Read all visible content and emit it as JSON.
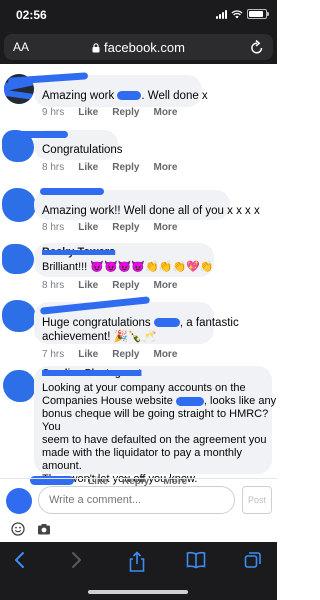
{
  "status_bar": {
    "time": "02:56"
  },
  "browser": {
    "aa_label": "AA",
    "url": "facebook.com"
  },
  "comments": [
    {
      "author": "",
      "text_before": "Amazing work ",
      "text_after": ". Well done x",
      "time": "9 hrs",
      "like": "Like",
      "reply": "Reply",
      "more": "More"
    },
    {
      "author": "",
      "text": "Congratulations",
      "time": "8 hrs",
      "like": "Like",
      "reply": "Reply",
      "more": "More"
    },
    {
      "author": "",
      "text": "Amazing work!! Well done all of you x x x x",
      "time": "8 hrs",
      "like": "Like",
      "reply": "Reply",
      "more": "More"
    },
    {
      "author": "Becky Towers",
      "text": "Brilliant!!! 😈😈😈😈👏👏👏💖👏",
      "time": "8 hrs",
      "like": "Like",
      "reply": "Reply",
      "more": "More"
    },
    {
      "author": "",
      "line1_before": "Huge congratulations ",
      "line1_after": ", a fantastic",
      "line2": "achievement! 🎉🍾🥂",
      "time": "7 hrs",
      "like": "Like",
      "reply": "Reply",
      "more": "More"
    },
    {
      "author": "Caroline Plantagenet",
      "lines": [
        "Looking at your company accounts on the",
        "Companies House website",
        ", looks like any",
        "bonus cheque will be going straight to HMRC? You",
        "seem to have defaulted on the agreement you",
        "made with the liquidator to pay a monthly amount.",
        "They won't let you off you know."
      ],
      "like": "Like",
      "reply": "Reply",
      "more": "More"
    }
  ],
  "reply_box": {
    "placeholder": "Write a comment...",
    "post_label": "Post"
  },
  "colors": {
    "chrome": "#1b1b1d",
    "bubble": "#f0f2f5",
    "redaction": "#2f6cf0"
  }
}
